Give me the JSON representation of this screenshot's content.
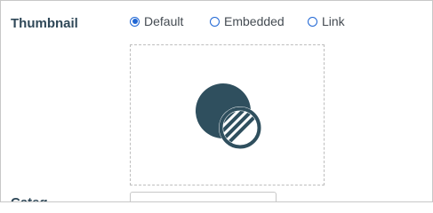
{
  "thumbnail": {
    "label": "Thumbnail",
    "options": [
      {
        "label": "Default",
        "selected": true
      },
      {
        "label": "Embedded",
        "selected": false
      },
      {
        "label": "Link",
        "selected": false
      }
    ],
    "placeholder_icon": "image-placeholder-icon"
  },
  "next_field": {
    "label": "Categ"
  },
  "colors": {
    "accent": "#1f66d4",
    "icon": "#2f4f5e",
    "label": "#2f4858"
  }
}
